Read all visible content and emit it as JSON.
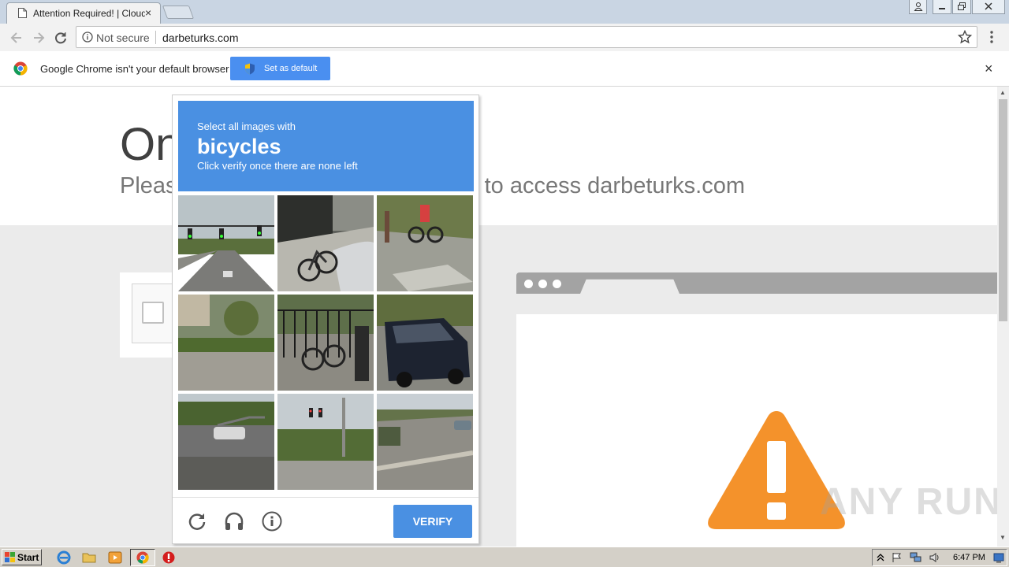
{
  "browser": {
    "tab_title": "Attention Required! | Cloudflare",
    "tab_close": "×",
    "omnibox": {
      "security_label": "Not secure",
      "url": "darbeturks.com"
    }
  },
  "infobar": {
    "message": "Google Chrome isn't your default browser",
    "button_label": "Set as default",
    "close": "×"
  },
  "page": {
    "title": "One more step",
    "subtitle": "Please complete the security check to access darbeturks.com"
  },
  "recaptcha": {
    "instruction": "Select all images with",
    "target": "bicycles",
    "hint": "Click verify once there are none left",
    "verify_label": "VERIFY",
    "tiles": [
      {
        "scene": "traffic-lights-road"
      },
      {
        "scene": "bicycle-parked-car"
      },
      {
        "scene": "cyclist-sidewalk"
      },
      {
        "scene": "yard-street"
      },
      {
        "scene": "bicycles-fence"
      },
      {
        "scene": "dark-suv"
      },
      {
        "scene": "highway-car"
      },
      {
        "scene": "traffic-light-intersection"
      },
      {
        "scene": "road-car"
      }
    ]
  },
  "watermark": "ANY RUN",
  "taskbar": {
    "start_label": "Start",
    "clock": "6:47 PM"
  },
  "colors": {
    "recaptcha_blue": "#4a90e2",
    "chrome_button_blue": "#4a8ff0",
    "warning_orange": "#f4922b"
  }
}
